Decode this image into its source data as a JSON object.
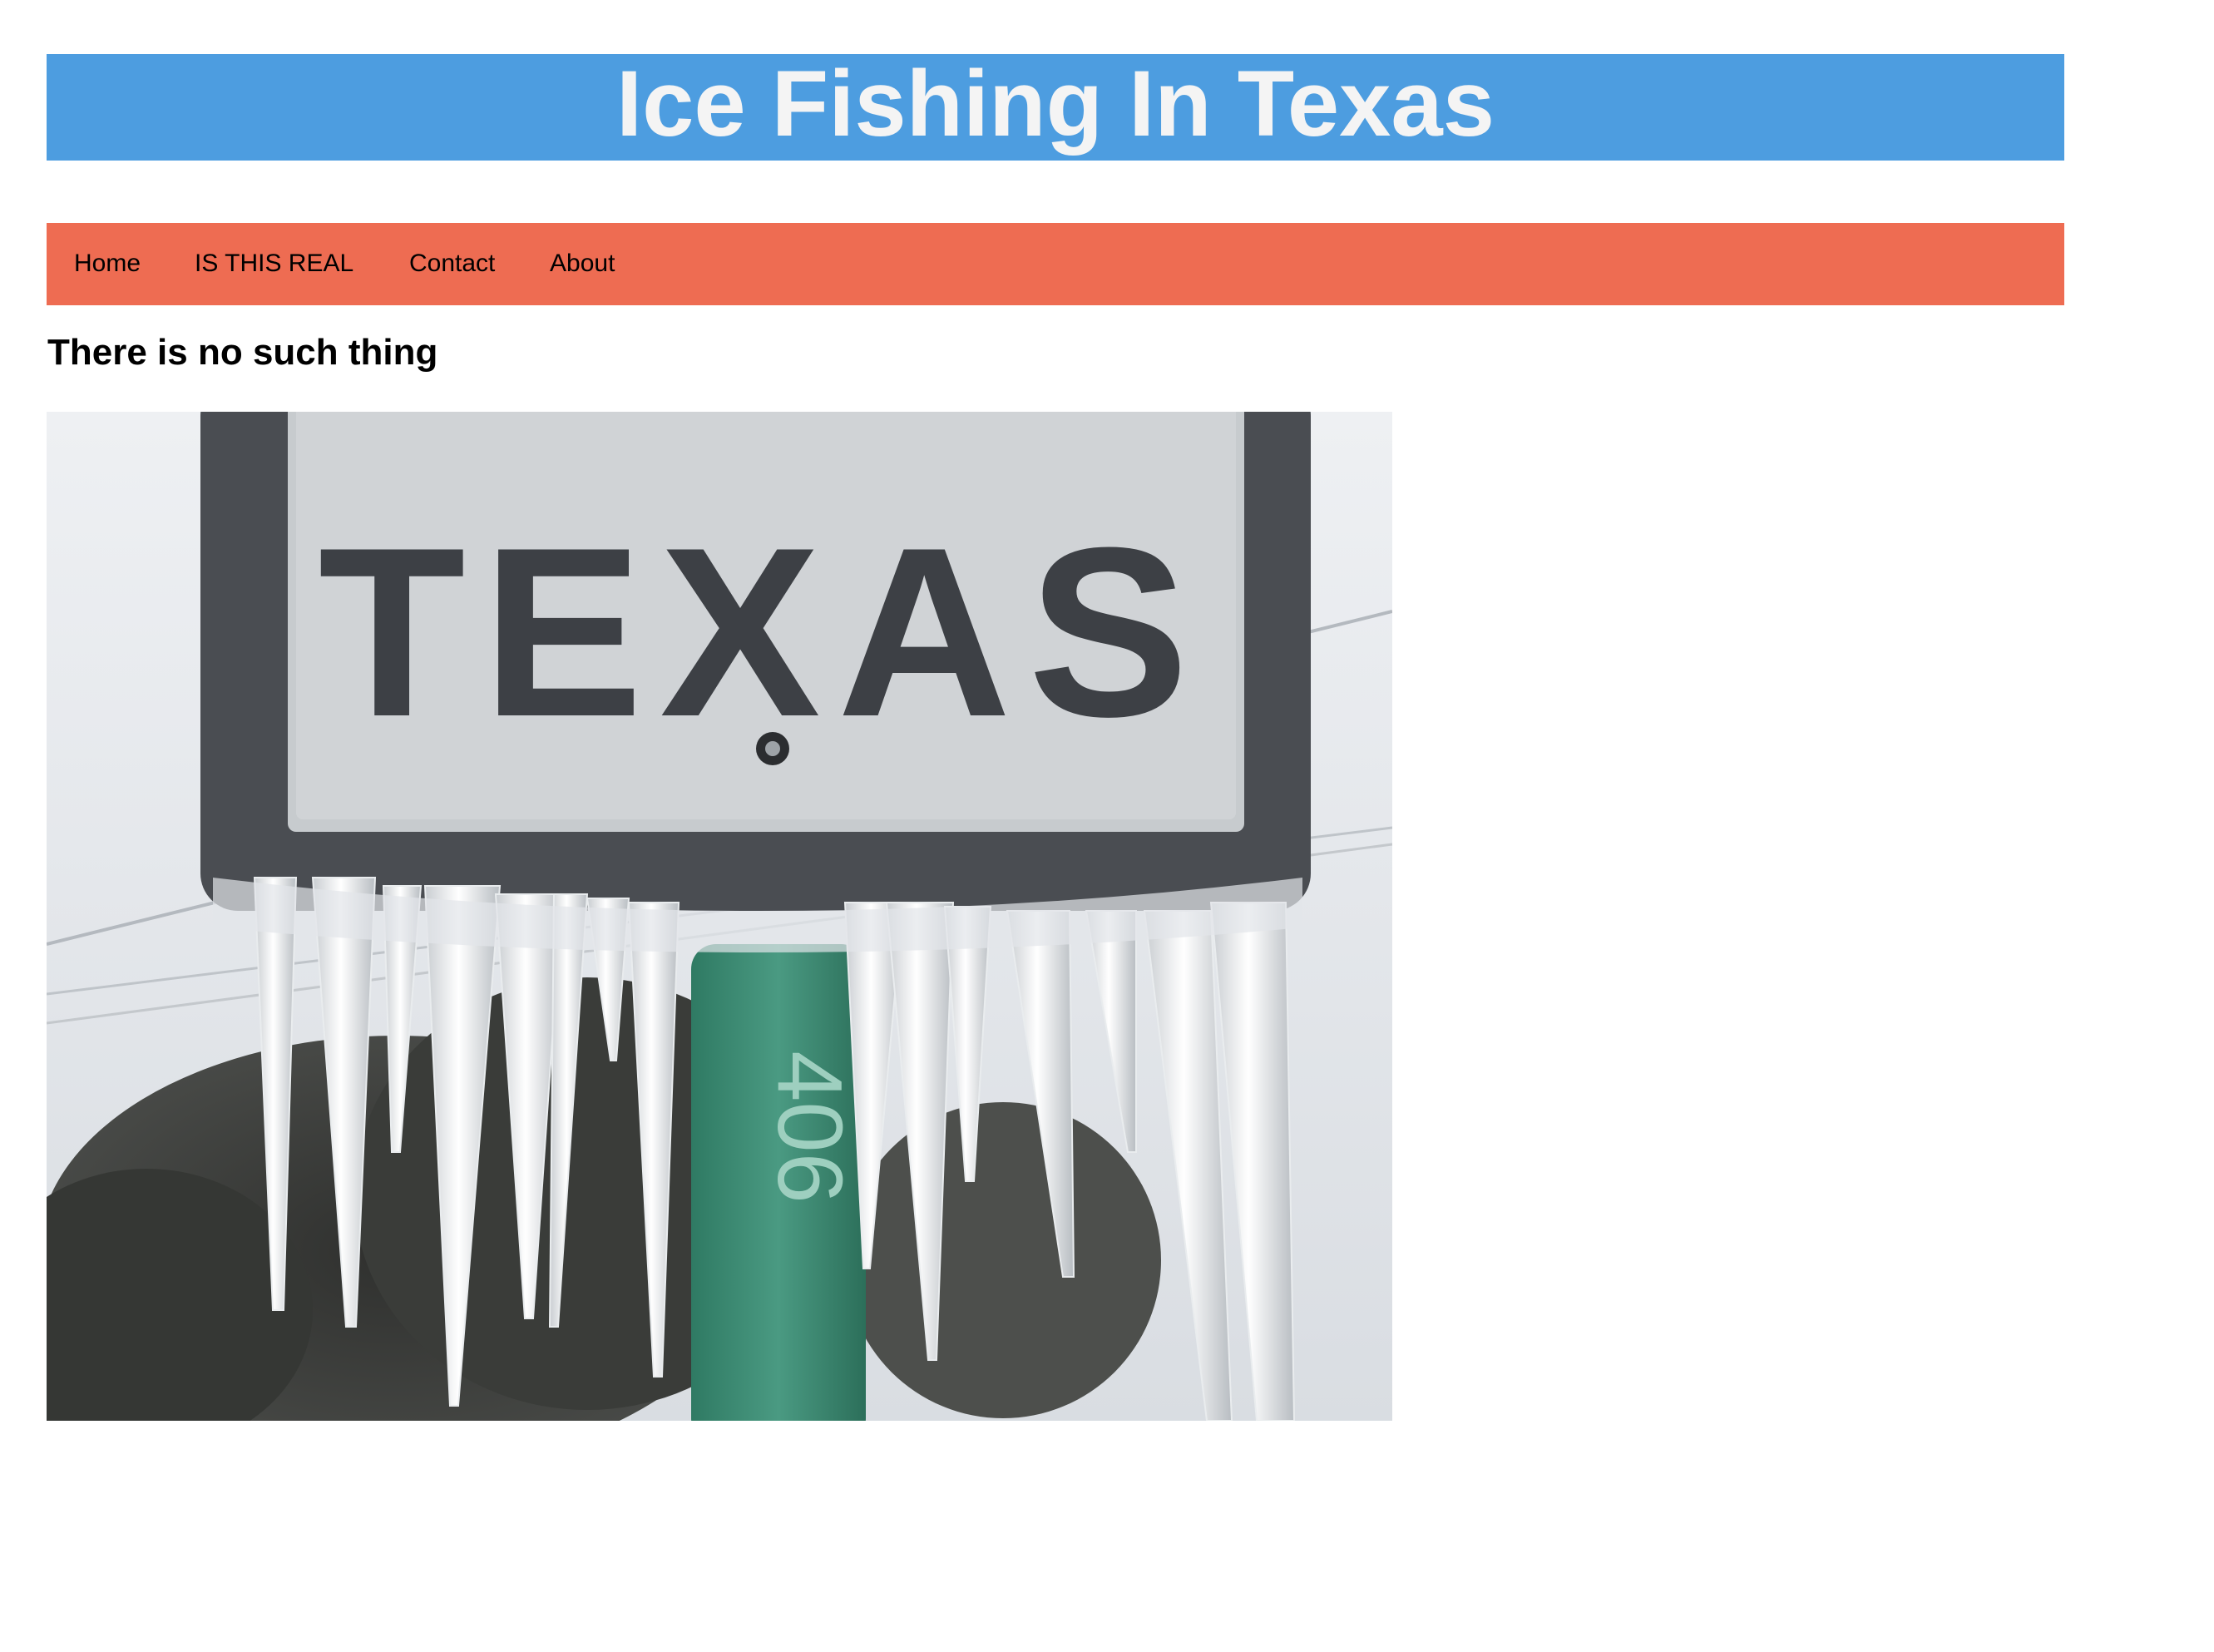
{
  "header": {
    "title": "Ice Fishing In Texas"
  },
  "nav": {
    "items": [
      "Home",
      "IS THIS REAL",
      "Contact",
      "About"
    ]
  },
  "main": {
    "heading": "There is no such thing",
    "photo": {
      "sign_text": "TEXAS",
      "post_number": "406"
    }
  },
  "colors": {
    "title_bar": "#4d9de0",
    "title_text": "#f4f4f4",
    "nav_bar": "#ee6c52",
    "post_green": "#3f8f78"
  }
}
